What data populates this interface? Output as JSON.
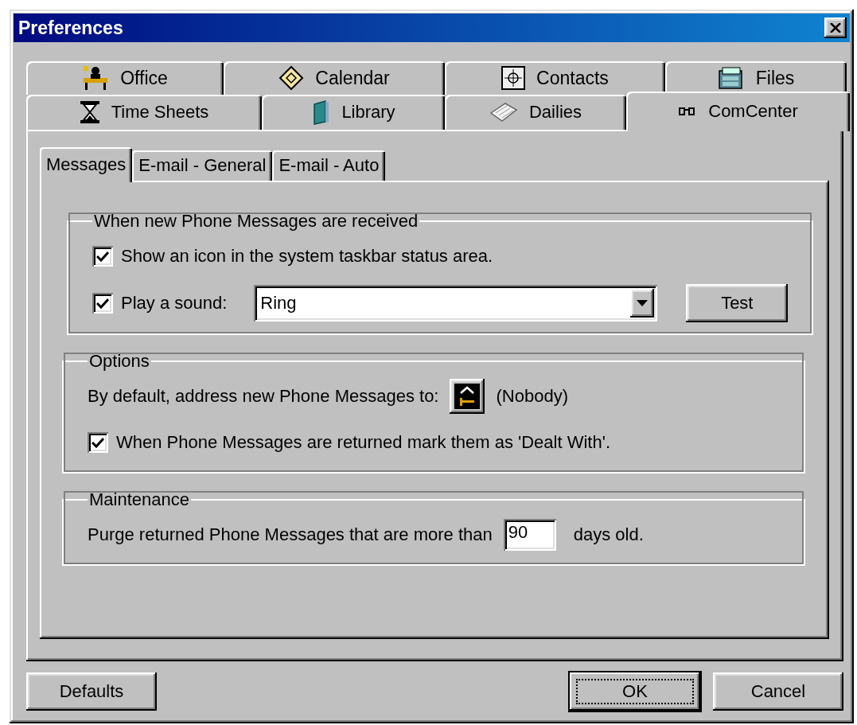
{
  "window": {
    "title": "Preferences"
  },
  "tab_rows": [
    [
      {
        "label": "Office",
        "selected": false
      },
      {
        "label": "Calendar",
        "selected": false
      },
      {
        "label": "Contacts",
        "selected": false
      },
      {
        "label": "Files",
        "selected": false
      }
    ],
    [
      {
        "label": "Time Sheets",
        "selected": false
      },
      {
        "label": "Library",
        "selected": false
      },
      {
        "label": "Dailies",
        "selected": false
      },
      {
        "label": "ComCenter",
        "selected": true
      }
    ]
  ],
  "subtabs": [
    {
      "label": "Messages",
      "selected": true
    },
    {
      "label": "E-mail - General",
      "selected": false
    },
    {
      "label": "E-mail - Auto",
      "selected": false
    }
  ],
  "groups": [
    {
      "title": "When new Phone Messages are received",
      "items": [
        {
          "kind": "checkbox",
          "label": "Show an icon in the system taskbar status area.",
          "checked": true
        },
        {
          "kind": "sound",
          "label": "Play a sound:",
          "checked": true,
          "value": "Ring",
          "button": "Test"
        }
      ]
    },
    {
      "title": "Options",
      "items": [
        {
          "kind": "recipient",
          "label": "By default, address new Phone Messages to:",
          "value": "(Nobody)"
        },
        {
          "kind": "checkbox",
          "label": "When Phone Messages are returned mark them as 'Dealt With'.",
          "checked": true
        }
      ]
    },
    {
      "title": "Maintenance",
      "items": [
        {
          "kind": "number",
          "label": "Purge returned Phone Messages that are more than",
          "value": "90",
          "suffix": "days old."
        }
      ]
    }
  ],
  "buttons": [
    {
      "label": "Defaults",
      "default": false
    },
    {
      "label": "OK",
      "default": true
    },
    {
      "label": "Cancel",
      "default": false
    }
  ]
}
